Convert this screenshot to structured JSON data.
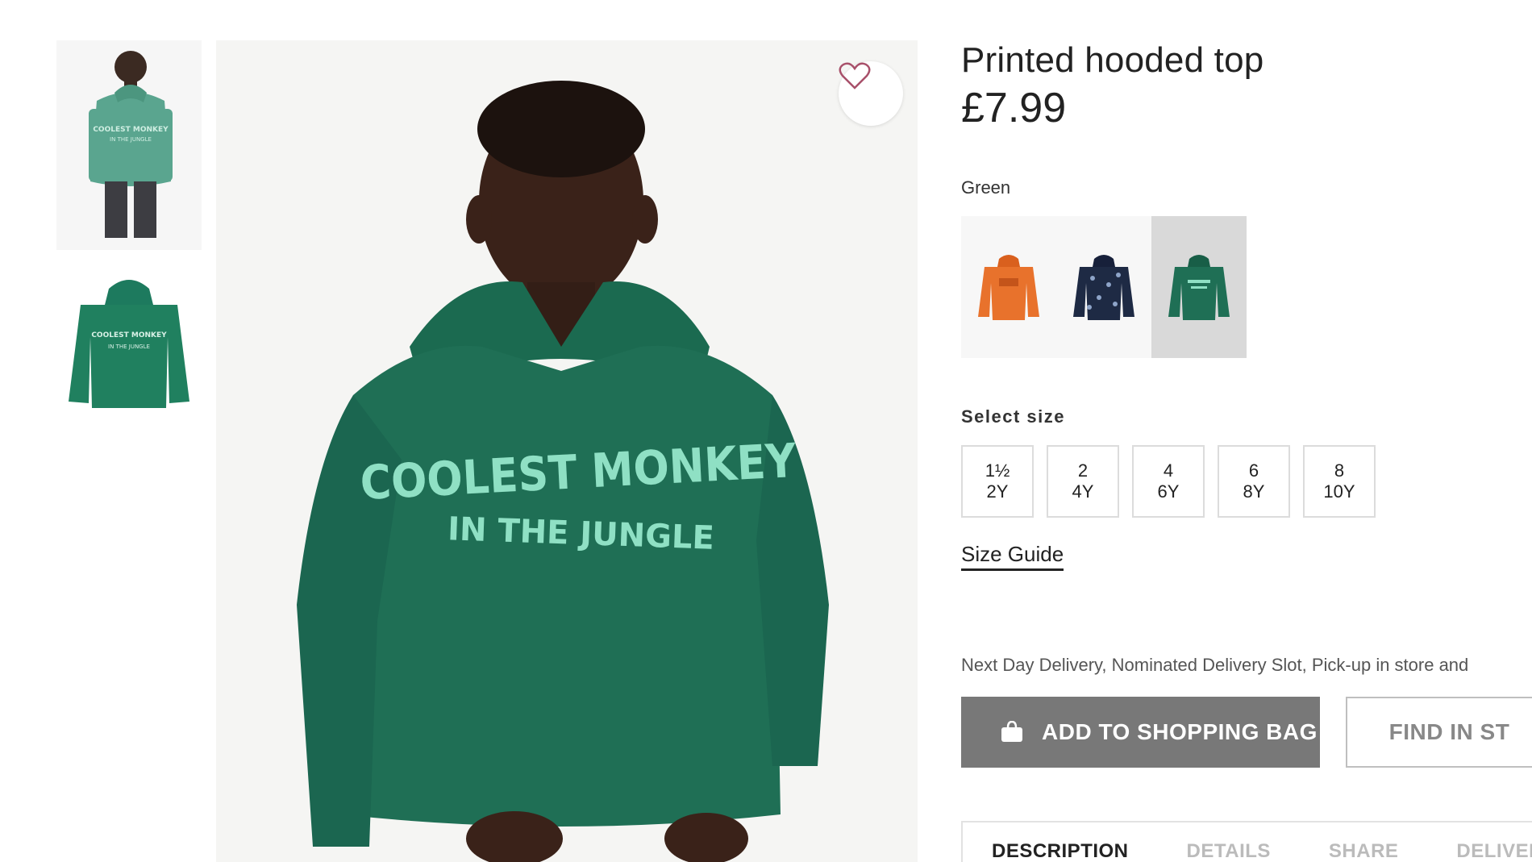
{
  "product": {
    "title": "Printed hooded top",
    "price": "£7.99",
    "color_label": "Green",
    "hoodie_print_line1": "COOLEST MONKEY",
    "hoodie_print_line2": "IN THE JUNGLE"
  },
  "colors": {
    "accent": "#787878",
    "hoodie_green": "#1f6f55",
    "swatch_selected_bg": "#d9d9d9"
  },
  "swatches": [
    {
      "name": "orange",
      "color": "#e8722c"
    },
    {
      "name": "navy",
      "color": "#1e2a44"
    },
    {
      "name": "green",
      "color": "#1f6f55",
      "selected": true
    }
  ],
  "size_section": {
    "label": "Select size",
    "sizes": [
      {
        "top": "1½",
        "bottom": "2Y"
      },
      {
        "top": "2",
        "bottom": "4Y"
      },
      {
        "top": "4",
        "bottom": "6Y"
      },
      {
        "top": "6",
        "bottom": "8Y"
      },
      {
        "top": "8",
        "bottom": "10Y"
      }
    ],
    "guide_label": "Size Guide"
  },
  "delivery_text": "Next Day Delivery, Nominated Delivery Slot, Pick-up in store and",
  "actions": {
    "add_to_bag": "ADD TO SHOPPING BAG",
    "find_in_store": "FIND IN ST"
  },
  "tabs": [
    "DESCRIPTION",
    "DETAILS",
    "SHARE",
    "DELIVER"
  ],
  "icons": {
    "favorite": "heart-icon",
    "bag": "shopping-bag-icon"
  }
}
